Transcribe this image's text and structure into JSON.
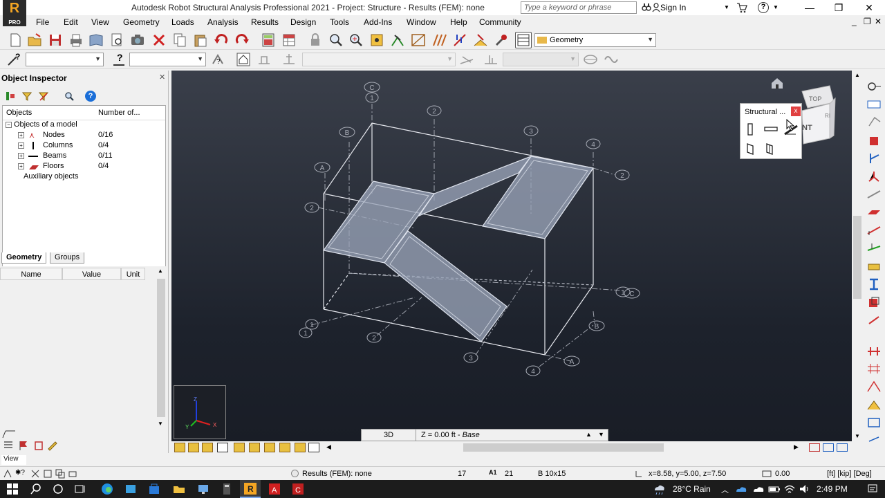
{
  "window": {
    "title": "Autodesk Robot Structural Analysis Professional 2021 - Project: Structure - Results (FEM): none",
    "logo_letter": "R",
    "logo_edition": "PRO",
    "search_placeholder": "Type a keyword or phrase",
    "sign_in": "Sign In",
    "help": "?"
  },
  "menu": [
    "File",
    "Edit",
    "View",
    "Geometry",
    "Loads",
    "Analysis",
    "Results",
    "Design",
    "Tools",
    "Add-Ins",
    "Window",
    "Help",
    "Community"
  ],
  "toolbar": {
    "layout_select": "Geometry"
  },
  "inspector": {
    "title": "Object Inspector",
    "col_objects": "Objects",
    "col_number": "Number of...",
    "root": "Objects of a model",
    "items": [
      {
        "label": "Nodes",
        "count": "0/16"
      },
      {
        "label": "Columns",
        "count": "0/4"
      },
      {
        "label": "Beams",
        "count": "0/11"
      },
      {
        "label": "Floors",
        "count": "0/4"
      }
    ],
    "auxiliary": "Auxiliary objects",
    "tabs": [
      "Geometry",
      "Groups"
    ],
    "prop_headers": [
      "Name",
      "Value",
      "Unit"
    ]
  },
  "viewport": {
    "grid_labels": [
      {
        "t": "C"
      },
      {
        "t": "1"
      },
      {
        "t": "2"
      },
      {
        "t": "B"
      },
      {
        "t": "3"
      },
      {
        "t": "4"
      },
      {
        "t": "A"
      },
      {
        "t": "2"
      },
      {
        "t": "2"
      },
      {
        "t": "1"
      },
      {
        "t": "C"
      },
      {
        "t": "B"
      },
      {
        "t": "1"
      },
      {
        "t": "1"
      },
      {
        "t": "2"
      },
      {
        "t": "3"
      },
      {
        "t": "4"
      },
      {
        "t": "A"
      }
    ],
    "cube_top": "TOP",
    "cube_front": "NT",
    "cube_right": "RI"
  },
  "struct_toolbar": {
    "title": "Structural ...",
    "close": "x"
  },
  "viewbar": {
    "mode": "3D",
    "level": "Z = 0.00 ft - ",
    "level_name": "Base"
  },
  "view_label": "View",
  "status": {
    "results": "Results (FEM): none",
    "count": "17",
    "node_count": "21",
    "section": "B 10x15",
    "coords": "x=8.58, y=5.00, z=7.50",
    "angle": "0.00",
    "units": "[ft] [kip] [Deg]"
  },
  "taskbar": {
    "weather": "28°C  Rain",
    "time": "2:49 PM"
  },
  "colors": {
    "viewport_top": "#3a3f4a",
    "viewport_bottom": "#191d26",
    "slab_fill": "#9aa4b8",
    "frame_line": "#e6e8ee",
    "close_red": "#e04040"
  }
}
